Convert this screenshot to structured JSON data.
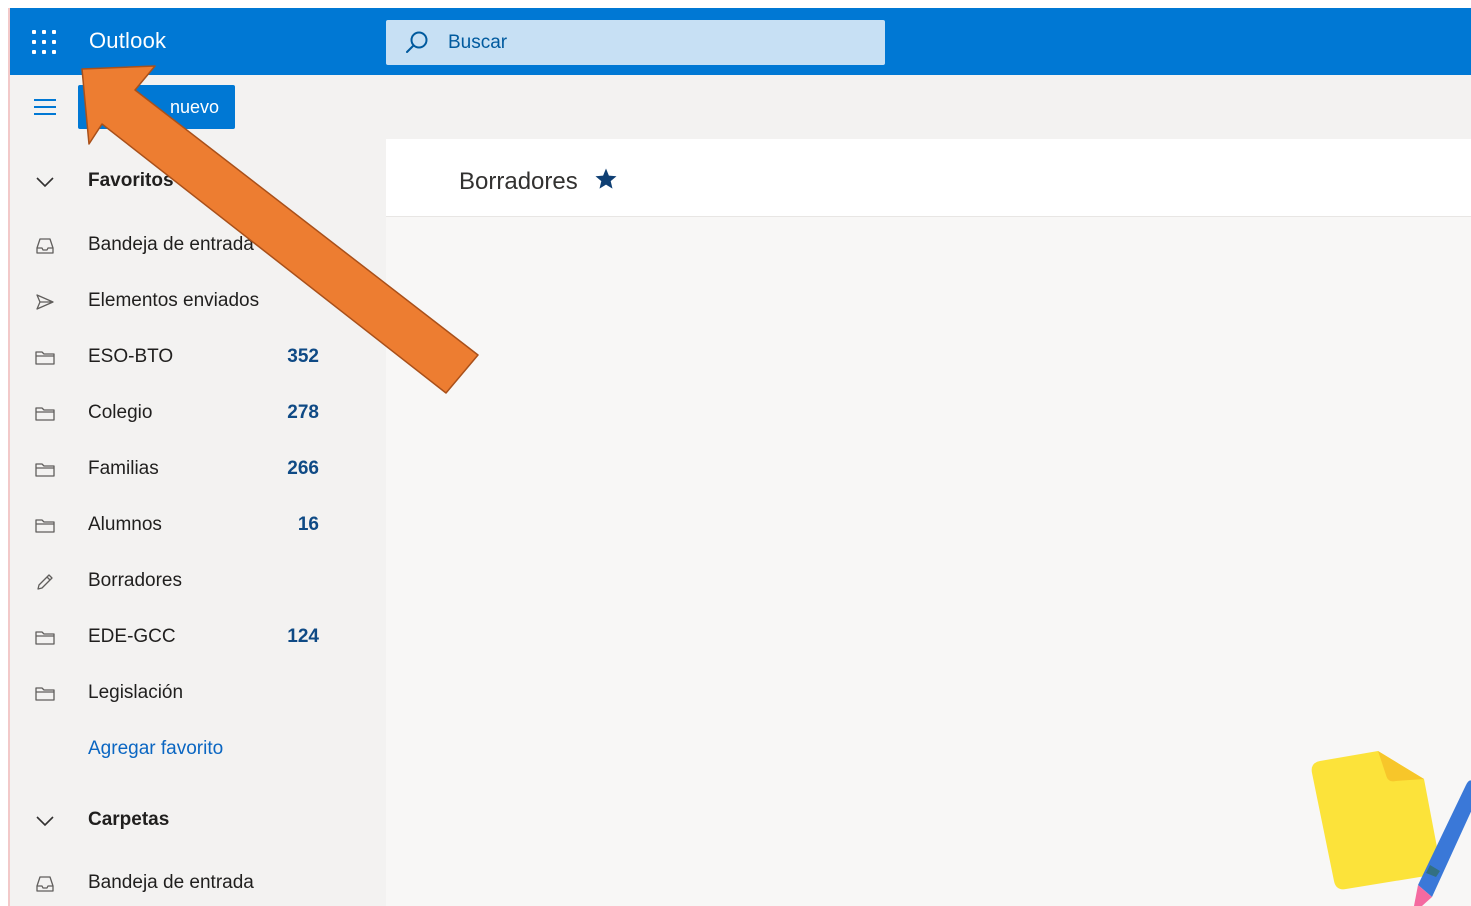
{
  "app": {
    "name": "Outlook"
  },
  "search": {
    "placeholder": "Buscar"
  },
  "toolbar": {
    "new_message_label": "nuevo"
  },
  "favorites": {
    "header": "Favoritos",
    "items": [
      {
        "label": "Bandeja de entrada",
        "count": "",
        "icon": "inbox-icon"
      },
      {
        "label": "Elementos enviados",
        "count": "",
        "icon": "send-icon"
      },
      {
        "label": "ESO-BTO",
        "count": "352",
        "icon": "folder-icon"
      },
      {
        "label": "Colegio",
        "count": "278",
        "icon": "folder-icon"
      },
      {
        "label": "Familias",
        "count": "266",
        "icon": "folder-icon"
      },
      {
        "label": "Alumnos",
        "count": "16",
        "icon": "folder-icon"
      },
      {
        "label": "Borradores",
        "count": "",
        "icon": "pencil-icon"
      },
      {
        "label": "EDE-GCC",
        "count": "124",
        "icon": "folder-icon"
      },
      {
        "label": "Legislación",
        "count": "",
        "icon": "folder-icon"
      }
    ],
    "add_label": "Agregar favorito"
  },
  "folders": {
    "header": "Carpetas",
    "items": [
      {
        "label": "Bandeja de entrada",
        "icon": "inbox-icon"
      }
    ]
  },
  "main": {
    "title": "Borradores"
  },
  "colors": {
    "brand": "#0078d4",
    "search_bg": "#c7e0f4",
    "count_text": "#0f4a85",
    "arrow": "#ed7d31"
  }
}
